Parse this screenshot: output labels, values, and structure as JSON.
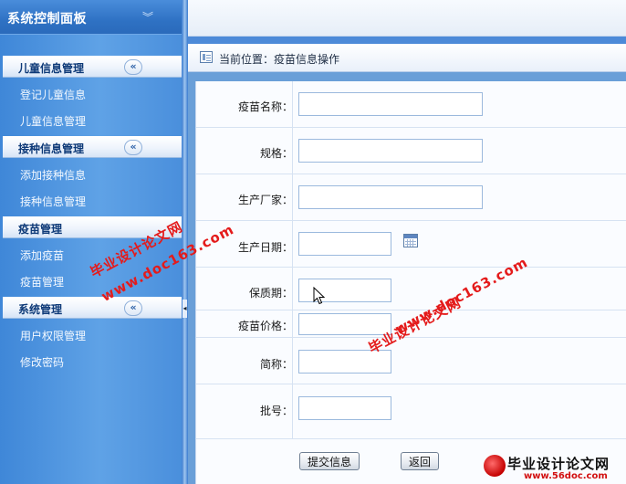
{
  "sidebar": {
    "title": "系统控制面板",
    "collapse_glyph": "︾",
    "groups": [
      {
        "label": "儿童信息管理",
        "toggle": "«",
        "items": [
          "登记儿童信息",
          "儿童信息管理"
        ]
      },
      {
        "label": "接种信息管理",
        "toggle": "«",
        "items": [
          "添加接种信息",
          "接种信息管理"
        ]
      },
      {
        "label": "疫苗管理",
        "toggle": "",
        "items": [
          "添加疫苗",
          "疫苗管理"
        ]
      },
      {
        "label": "系统管理",
        "toggle": "«",
        "items": [
          "用户权限管理",
          "修改密码"
        ]
      }
    ]
  },
  "splitter": {
    "arrow": "◂"
  },
  "breadcrumb": {
    "text": "当前位置：疫苗信息操作"
  },
  "form": {
    "fields": [
      {
        "label": "疫苗名称：",
        "value": ""
      },
      {
        "label": "规格：",
        "value": ""
      },
      {
        "label": "生产厂家：",
        "value": ""
      },
      {
        "label": "生产日期：",
        "value": ""
      },
      {
        "label": "保质期：",
        "value": ""
      },
      {
        "label": "疫苗价格：",
        "value": ""
      },
      {
        "label": "简称：",
        "value": ""
      },
      {
        "label": "批号：",
        "value": ""
      }
    ],
    "submit_label": "提交信息",
    "back_label": "返回"
  },
  "watermarks": {
    "site_cn": "毕业设计论文网",
    "site_url": "www.doc163.com",
    "brand_cn": "毕业设计论文网",
    "brand_url": "www.56doc.com"
  },
  "icons": {
    "breadcrumb": "page-icon",
    "date_picker": "calendar-icon"
  },
  "colors": {
    "sidebar_blue": "#4a8fdc",
    "group_header_text": "#0e3a78",
    "watermark_red": "#e41b1b"
  }
}
